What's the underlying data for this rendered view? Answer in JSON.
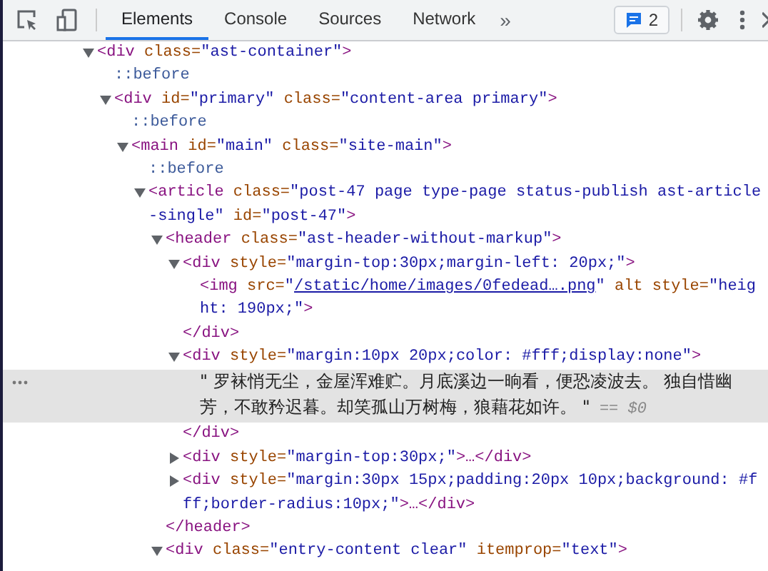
{
  "toolbar": {
    "tabs": [
      {
        "label": "Elements",
        "selected": true
      },
      {
        "label": "Console",
        "selected": false
      },
      {
        "label": "Sources",
        "selected": false
      },
      {
        "label": "Network",
        "selected": false
      }
    ],
    "more_tabs": "»",
    "issues_count": "2"
  },
  "tree": [
    {
      "kind": "element",
      "expanded": true,
      "selected": false,
      "open": [
        {
          "kind": "tag",
          "text": "<div"
        },
        {
          "kind": "name",
          "text": " class="
        },
        {
          "kind": "value",
          "text": "\"ast-container\""
        },
        {
          "kind": "tag",
          "text": ">"
        }
      ],
      "children": [
        {
          "kind": "pseudo",
          "selected": false,
          "open": [
            {
              "kind": "pseudo",
              "text": "::before"
            }
          ]
        },
        {
          "kind": "element",
          "expanded": true,
          "selected": false,
          "open": [
            {
              "kind": "tag",
              "text": "<div"
            },
            {
              "kind": "name",
              "text": " id="
            },
            {
              "kind": "value",
              "text": "\"primary\""
            },
            {
              "kind": "name",
              "text": " class="
            },
            {
              "kind": "value",
              "text": "\"content-area primary\""
            },
            {
              "kind": "tag",
              "text": ">"
            }
          ],
          "children": [
            {
              "kind": "pseudo",
              "selected": false,
              "open": [
                {
                  "kind": "pseudo",
                  "text": "::before"
                }
              ]
            },
            {
              "kind": "element",
              "expanded": true,
              "selected": false,
              "open": [
                {
                  "kind": "tag",
                  "text": "<main"
                },
                {
                  "kind": "name",
                  "text": " id="
                },
                {
                  "kind": "value",
                  "text": "\"main\""
                },
                {
                  "kind": "name",
                  "text": " class="
                },
                {
                  "kind": "value",
                  "text": "\"site-main\""
                },
                {
                  "kind": "tag",
                  "text": ">"
                }
              ],
              "children": [
                {
                  "kind": "pseudo",
                  "selected": false,
                  "open": [
                    {
                      "kind": "pseudo",
                      "text": "::before"
                    }
                  ]
                },
                {
                  "kind": "element",
                  "expanded": true,
                  "selected": false,
                  "open": [
                    {
                      "kind": "tag",
                      "text": "<article"
                    },
                    {
                      "kind": "name",
                      "text": " class="
                    },
                    {
                      "kind": "value",
                      "text": "\"post-47 page type-page status-publish ast-article-single\""
                    },
                    {
                      "kind": "name",
                      "text": " id="
                    },
                    {
                      "kind": "value",
                      "text": "\"post-47\""
                    },
                    {
                      "kind": "tag",
                      "text": ">"
                    }
                  ],
                  "children": [
                    {
                      "kind": "element",
                      "expanded": true,
                      "selected": false,
                      "open": [
                        {
                          "kind": "tag",
                          "text": "<header"
                        },
                        {
                          "kind": "name",
                          "text": " class="
                        },
                        {
                          "kind": "value",
                          "text": "\"ast-header-without-markup\""
                        },
                        {
                          "kind": "tag",
                          "text": ">"
                        }
                      ],
                      "children": [
                        {
                          "kind": "element",
                          "expanded": true,
                          "selected": false,
                          "open": [
                            {
                              "kind": "tag",
                              "text": "<div"
                            },
                            {
                              "kind": "name",
                              "text": " style="
                            },
                            {
                              "kind": "value",
                              "text": "\"margin-top:30px;margin-left: 20px;\""
                            },
                            {
                              "kind": "tag",
                              "text": ">"
                            }
                          ],
                          "children": [
                            {
                              "kind": "leaf",
                              "selected": false,
                              "open": [
                                {
                                  "kind": "tag",
                                  "text": "<img"
                                },
                                {
                                  "kind": "name",
                                  "text": " src="
                                },
                                {
                                  "kind": "value",
                                  "text": "\""
                                },
                                {
                                  "kind": "link",
                                  "text": "/static/home/images/0fedead….png"
                                },
                                {
                                  "kind": "value",
                                  "text": "\""
                                },
                                {
                                  "kind": "name",
                                  "text": " alt style="
                                },
                                {
                                  "kind": "value",
                                  "text": "\"height: 190px;\""
                                },
                                {
                                  "kind": "tag",
                                  "text": ">"
                                }
                              ]
                            }
                          ],
                          "close": [
                            {
                              "kind": "tag",
                              "text": "</div>"
                            }
                          ]
                        },
                        {
                          "kind": "element",
                          "expanded": true,
                          "selected": false,
                          "open": [
                            {
                              "kind": "tag",
                              "text": "<div"
                            },
                            {
                              "kind": "name",
                              "text": " style="
                            },
                            {
                              "kind": "value",
                              "text": "\"margin:10px 20px;color: #fff;display:none\""
                            },
                            {
                              "kind": "tag",
                              "text": ">"
                            }
                          ],
                          "children": [
                            {
                              "kind": "text",
                              "selected": true,
                              "open": [
                                {
                                  "kind": "text",
                                  "text": "\" 罗袜悄无尘，金屋浑难贮。月底溪边一晌看，便恐凌波去。 独自惜幽芳，不敢矜迟暮。却笑孤山万树梅，狼藉花如许。 \""
                                },
                                {
                                  "kind": "ref",
                                  "text": " == $0"
                                }
                              ]
                            }
                          ],
                          "close": [
                            {
                              "kind": "tag",
                              "text": "</div>"
                            }
                          ]
                        },
                        {
                          "kind": "element",
                          "expanded": false,
                          "selected": false,
                          "open": [
                            {
                              "kind": "tag",
                              "text": "<div"
                            },
                            {
                              "kind": "name",
                              "text": " style="
                            },
                            {
                              "kind": "value",
                              "text": "\"margin-top:30px;\""
                            },
                            {
                              "kind": "tag",
                              "text": ">…</div>"
                            }
                          ]
                        },
                        {
                          "kind": "element",
                          "expanded": false,
                          "selected": false,
                          "open": [
                            {
                              "kind": "tag",
                              "text": "<div"
                            },
                            {
                              "kind": "name",
                              "text": " style="
                            },
                            {
                              "kind": "value",
                              "text": "\"margin:30px 15px;padding:20px 10px;background: #fff;border-radius:10px;\""
                            },
                            {
                              "kind": "tag",
                              "text": ">…</div>"
                            }
                          ]
                        }
                      ],
                      "close": [
                        {
                          "kind": "tag",
                          "text": "</header>"
                        }
                      ]
                    },
                    {
                      "kind": "element",
                      "expanded": true,
                      "selected": false,
                      "open": [
                        {
                          "kind": "tag",
                          "text": "<div"
                        },
                        {
                          "kind": "name",
                          "text": " class="
                        },
                        {
                          "kind": "value",
                          "text": "\"entry-content clear\""
                        },
                        {
                          "kind": "name",
                          "text": " itemprop="
                        },
                        {
                          "kind": "value",
                          "text": "\"text\""
                        },
                        {
                          "kind": "tag",
                          "text": ">"
                        }
                      ]
                    }
                  ]
                }
              ]
            }
          ]
        }
      ]
    }
  ]
}
